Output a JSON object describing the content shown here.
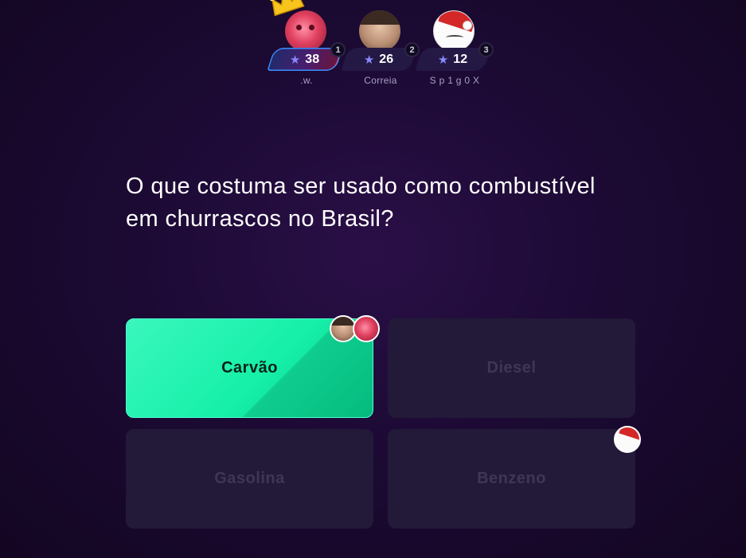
{
  "players": [
    {
      "name": ".w.",
      "score": "38",
      "rank": "1",
      "avatar": "pink-avatar",
      "crown": true
    },
    {
      "name": "Correia",
      "score": "26",
      "rank": "2",
      "avatar": "face-avatar",
      "crown": false
    },
    {
      "name": "S p 1 g 0 X",
      "score": "12",
      "rank": "3",
      "avatar": "santa-cat-avatar",
      "crown": false
    }
  ],
  "question": "O que costuma ser usado como combustível em churrascos no Brasil?",
  "answers": [
    {
      "label": "Carvão",
      "state": "correct"
    },
    {
      "label": "Diesel",
      "state": "dim"
    },
    {
      "label": "Gasolina",
      "state": "dim"
    },
    {
      "label": "Benzeno",
      "state": "dim"
    }
  ],
  "icons": {
    "star": "star-icon",
    "crown": "crown-icon"
  },
  "colors": {
    "correct": "#16f0a8",
    "dim": "#221a38",
    "star": "#8a86ff"
  }
}
